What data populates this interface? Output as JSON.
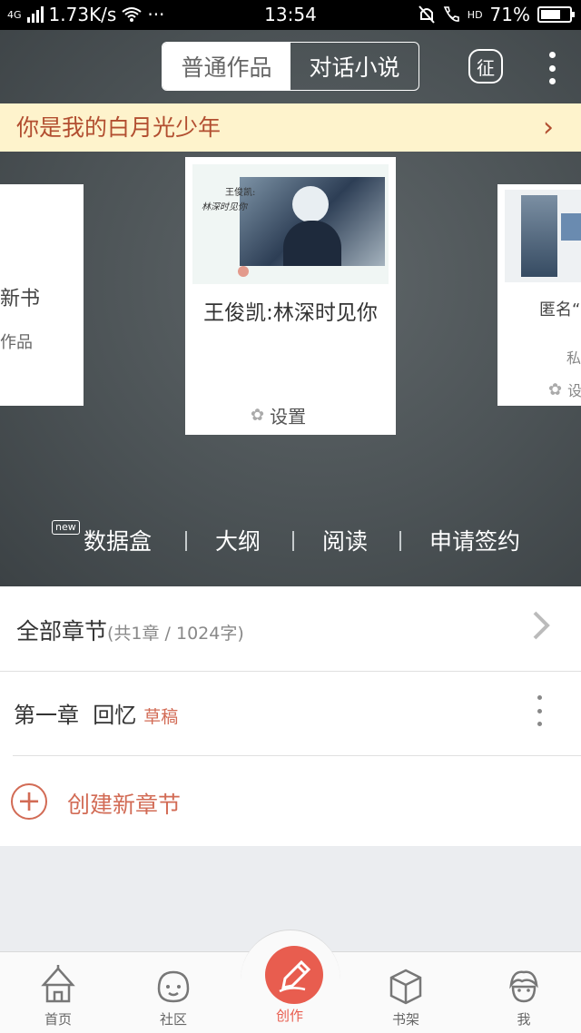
{
  "status_bar": {
    "network": "4G",
    "speed": "1.73K/s",
    "dots": "···",
    "time": "13:54",
    "hd": "HD",
    "battery": "71%",
    "battery_level": 0.71
  },
  "top_tabs": [
    {
      "label": "普通作品",
      "active": true
    },
    {
      "label": "对话小说",
      "active": false
    }
  ],
  "zheng_icon_label": "征",
  "banner": {
    "text": "你是我的白月光少年",
    "chevron": "›"
  },
  "left_card": {
    "plus": "+",
    "title": "新书",
    "subtitle": "作品"
  },
  "main_card": {
    "cover_line1": "王俊凯:",
    "cover_line2": "林深时见你",
    "title": "王俊凯:林深时见你",
    "settings_label": "设置"
  },
  "right_card": {
    "title": "匿名“",
    "subtitle": "私",
    "settings_label": "设"
  },
  "gear_glyph": "✿",
  "actions": {
    "new_tag": "new",
    "items": [
      "数据盒",
      "大纲",
      "阅读",
      "申请签约"
    ]
  },
  "chapters": {
    "all_label": "全部章节",
    "all_stats": "(共1章 / 1024字)",
    "items": [
      {
        "title": "第一章  回忆",
        "status": "草稿"
      }
    ],
    "create_plus": "+",
    "create_label": "创建新章节"
  },
  "tabbar": {
    "items": [
      "首页",
      "社区",
      "创作",
      "书架",
      "我"
    ],
    "active": "创作"
  },
  "colors": {
    "accent": "#e85d4f",
    "banner_bg": "#fef3cc",
    "banner_text": "#b24e30",
    "hero_bg": "#4c5356"
  }
}
